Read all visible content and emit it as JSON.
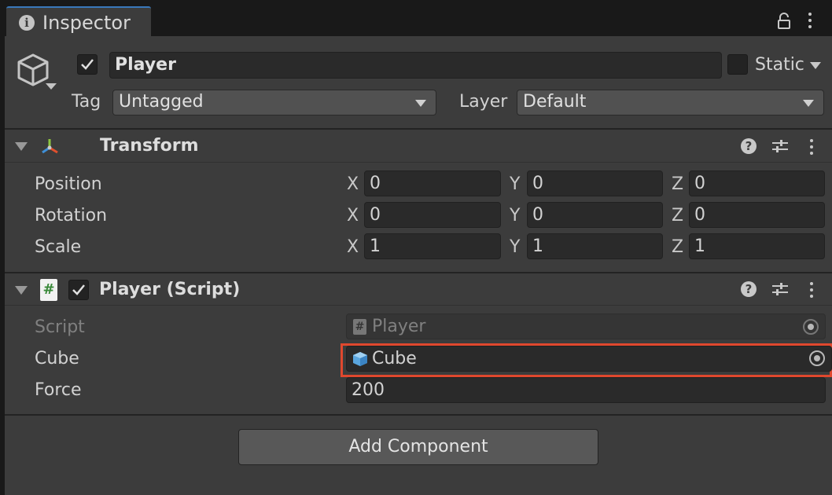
{
  "window": {
    "tab_title": "Inspector",
    "tab_icon": "info-icon"
  },
  "object": {
    "name": "Player",
    "active": true,
    "static_label": "Static",
    "static_checked": false,
    "tag_label": "Tag",
    "tag_value": "Untagged",
    "layer_label": "Layer",
    "layer_value": "Default"
  },
  "transform": {
    "title": "Transform",
    "rows": [
      {
        "label": "Position",
        "x": "0",
        "y": "0",
        "z": "0"
      },
      {
        "label": "Rotation",
        "x": "0",
        "y": "0",
        "z": "0"
      },
      {
        "label": "Scale",
        "x": "1",
        "y": "1",
        "z": "1"
      }
    ],
    "axis_labels": {
      "x": "X",
      "y": "Y",
      "z": "Z"
    }
  },
  "script_component": {
    "title": "Player (Script)",
    "enabled": true,
    "fields": [
      {
        "label": "Script",
        "value": "Player",
        "icon": "script-hash-icon",
        "disabled": true
      },
      {
        "label": "Cube",
        "value": "Cube",
        "icon": "cube-icon",
        "highlighted": true
      },
      {
        "label": "Force",
        "value": "200"
      }
    ]
  },
  "add_component_label": "Add Component",
  "colors": {
    "panel_bg": "#3c3c3c",
    "field_bg": "#2a2a2a",
    "highlight_border": "#e0482e",
    "accent_tab": "#3a79bb"
  }
}
